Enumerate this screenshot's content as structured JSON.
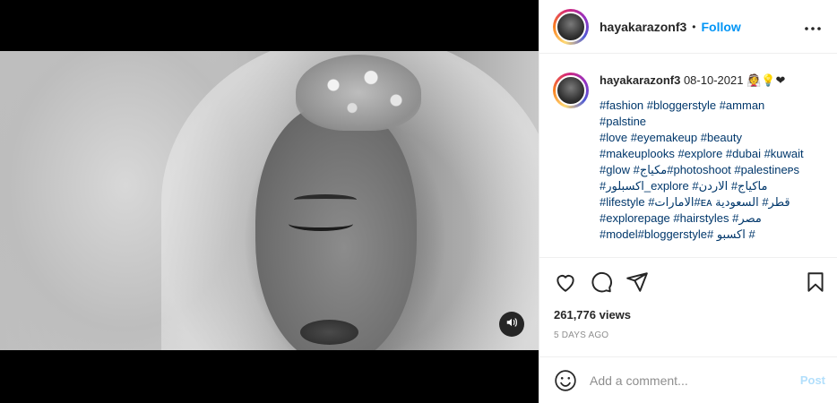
{
  "header": {
    "username": "hayakarazonf3",
    "separator": "•",
    "follow_label": "Follow"
  },
  "caption": {
    "username": "hayakarazonf3",
    "date": "08-10-2021",
    "emojis": "👰💡❤",
    "hashtags": "#fashion #bloggerstyle #amman\n#palstine\n#love #eyemakeup #beauty\n#makeuplooks #explore #dubai #kuwait\n#glow #مكياج#photoshoot #palestineᴘs\n#اكسبلور_explore #ماكياج# الاردن\n#lifestyle #الامارات#ᴇᴀ قطر# السعودية\n#explorepage #hairstyles #مصر\n#model#bloggerstyle# اكسبو #"
  },
  "stats": {
    "views": "261,776 views",
    "time_ago": "5 DAYS AGO"
  },
  "comment": {
    "placeholder": "Add a comment...",
    "post_label": "Post"
  },
  "icons": {
    "avatar": "profile-picture",
    "more": "more-horizontal-icon",
    "like": "heart-icon",
    "comment": "comment-icon",
    "share": "paper-plane-icon",
    "save": "bookmark-icon",
    "emoji": "emoji-smile-icon",
    "sound": "speaker-icon"
  },
  "colors": {
    "follow": "#0095f6",
    "hashtag": "#00376b",
    "post_disabled": "#b2dffc",
    "muted": "#8e8e8e"
  }
}
